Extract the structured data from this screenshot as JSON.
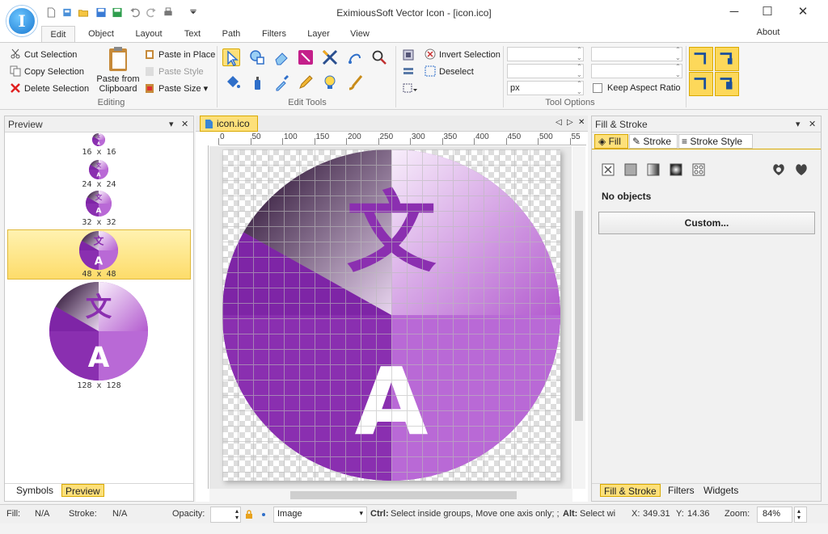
{
  "window": {
    "title": "EximiousSoft Vector Icon - [icon.ico]",
    "app_icon_letter": "I"
  },
  "ribbon_tabs": [
    {
      "label": "Edit"
    },
    {
      "label": "Object"
    },
    {
      "label": "Layout"
    },
    {
      "label": "Text"
    },
    {
      "label": "Path"
    },
    {
      "label": "Filters"
    },
    {
      "label": "Layer"
    },
    {
      "label": "View"
    }
  ],
  "about_label": "About",
  "editing": {
    "cut": "Cut Selection",
    "copy": "Copy Selection",
    "delete": "Delete Selection",
    "paste_from": "Paste from",
    "paste_clipboard": "Clipboard",
    "paste_in_place": "Paste in Place",
    "paste_style": "Paste Style",
    "paste_size": "Paste Size",
    "group_label": "Editing"
  },
  "edit_tools": {
    "group_label": "Edit Tools"
  },
  "selection": {
    "invert": "Invert Selection",
    "deselect": "Deselect"
  },
  "tool_options": {
    "unit": "px",
    "keep_aspect": "Keep Aspect Ratio",
    "group_label": "Tool Options"
  },
  "preview_panel": {
    "title": "Preview",
    "items": [
      {
        "label": "16 x 16"
      },
      {
        "label": "24 x 24"
      },
      {
        "label": "32 x 32"
      },
      {
        "label": "48 x 48"
      },
      {
        "label": "128 x 128"
      }
    ],
    "tabs": [
      "Symbols",
      "Preview"
    ]
  },
  "document": {
    "tab": "icon.ico",
    "ruler_ticks": [
      "0",
      "50",
      "100",
      "150",
      "200",
      "250",
      "300",
      "350",
      "400",
      "450",
      "500",
      "55"
    ],
    "glyph_top": "文",
    "glyph_bottom": "A"
  },
  "fill_stroke": {
    "title": "Fill & Stroke",
    "tabs": [
      "Fill",
      "Stroke",
      "Stroke Style"
    ],
    "no_objects": "No objects",
    "custom": "Custom...",
    "bottom_tabs": [
      "Fill & Stroke",
      "Filters",
      "Widgets"
    ]
  },
  "status": {
    "fill_label": "Fill:",
    "fill_value": "N/A",
    "stroke_label": "Stroke:",
    "stroke_value": "N/A",
    "opacity_label": "Opacity:",
    "layer_value": "Image",
    "hint_ctrl": "Ctrl:",
    "hint_text1": "Select inside groups, Move one axis only; ;",
    "hint_alt": "Alt:",
    "hint_text2": "Select wi",
    "x_label": "X:",
    "x_value": "349.31",
    "y_label": "Y:",
    "y_value": "14.36",
    "zoom_label": "Zoom:",
    "zoom_value": "84%"
  },
  "colors": {
    "accent_blue": "#1a78d0",
    "selection_yellow": "#fde07a",
    "icon_purple": "#8b2fb0"
  }
}
